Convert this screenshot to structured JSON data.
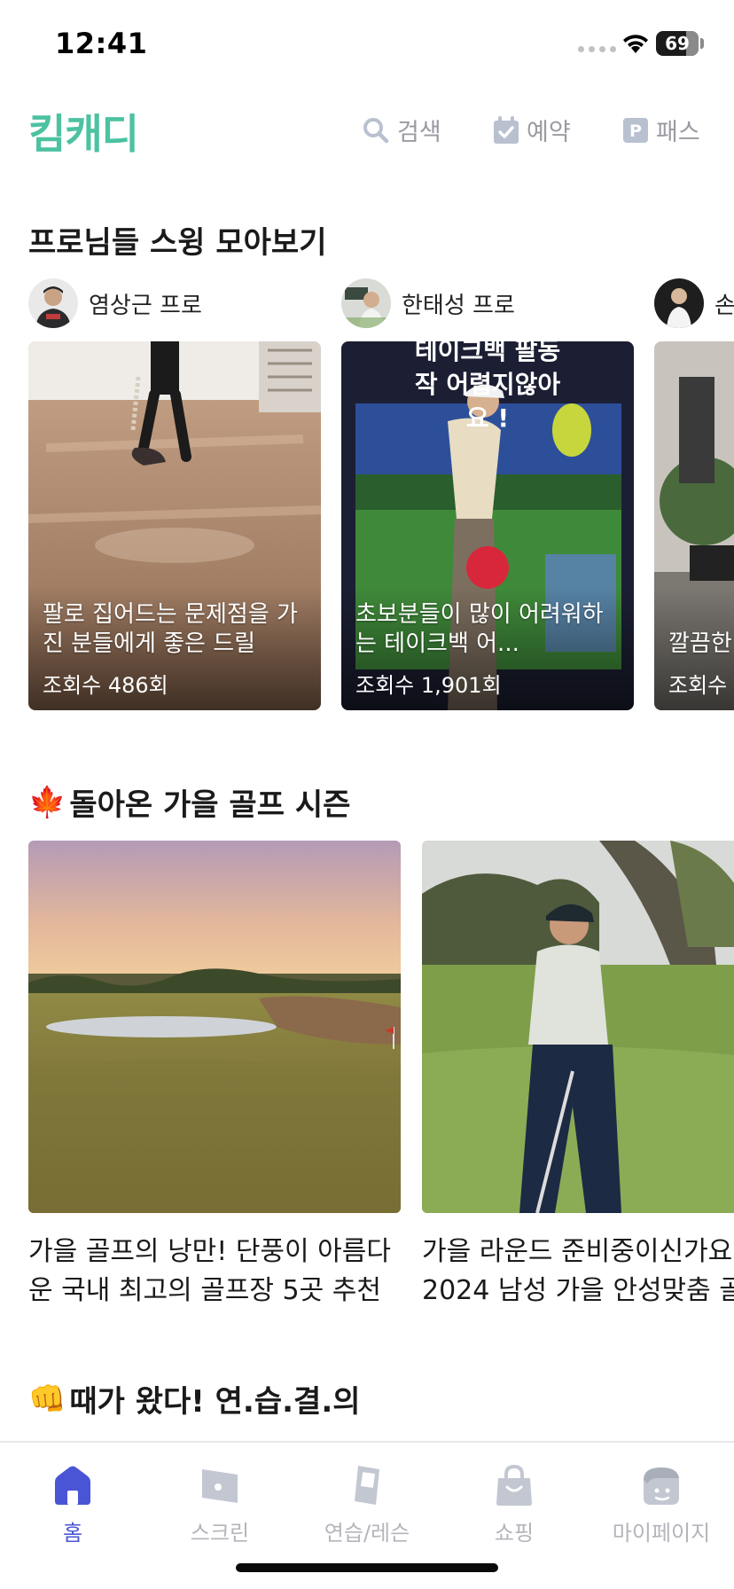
{
  "status_bar": {
    "time": "12:41",
    "battery": "69"
  },
  "header": {
    "logo": "킴캐디",
    "search_label": "검색",
    "reserve_label": "예약",
    "pass_label": "패스",
    "pass_badge": "P"
  },
  "swing_section": {
    "title": "프로님들 스윙 모아보기",
    "pros": [
      {
        "name": "염상근 프로"
      },
      {
        "name": "한태성 프로"
      },
      {
        "name": "손"
      }
    ],
    "videos": [
      {
        "caption": "팔로 집어드는 문제점을 가진 분들에게 좋은 드릴",
        "views": "조회수 486회"
      },
      {
        "overlay": "테이크백 팔동작 어렵지않아요 !",
        "caption": "초보분들이 많이 어려워하는 테이크백 어...",
        "views": "조회수 1,901회"
      },
      {
        "caption": "깔끔한",
        "views": "조회수"
      }
    ]
  },
  "autumn_section": {
    "emoji": "🍁",
    "title": "돌아온 가을 골프 시즌",
    "articles": [
      {
        "title_line1": "가을 골프의 낭만! 단풍이 아름다",
        "title_line2": "운 국내 최고의 골프장 5곳 추천"
      },
      {
        "title_line1": "가을 라운드 준비중이신가요?",
        "title_line2": "2024 남성 가을 안성맞춤 골"
      }
    ]
  },
  "practice_section": {
    "emoji": "👊",
    "title": "때가 왔다! 연.습.결.의"
  },
  "tabbar": {
    "active_color": "#4a55d6",
    "inactive_color": "#b4b4bc",
    "tabs": [
      {
        "label": "홈",
        "icon": "home-icon"
      },
      {
        "label": "스크린",
        "icon": "screen-icon"
      },
      {
        "label": "연습/레슨",
        "icon": "practice-icon"
      },
      {
        "label": "쇼핑",
        "icon": "shopping-bag-icon"
      },
      {
        "label": "마이페이지",
        "icon": "profile-icon"
      }
    ]
  }
}
